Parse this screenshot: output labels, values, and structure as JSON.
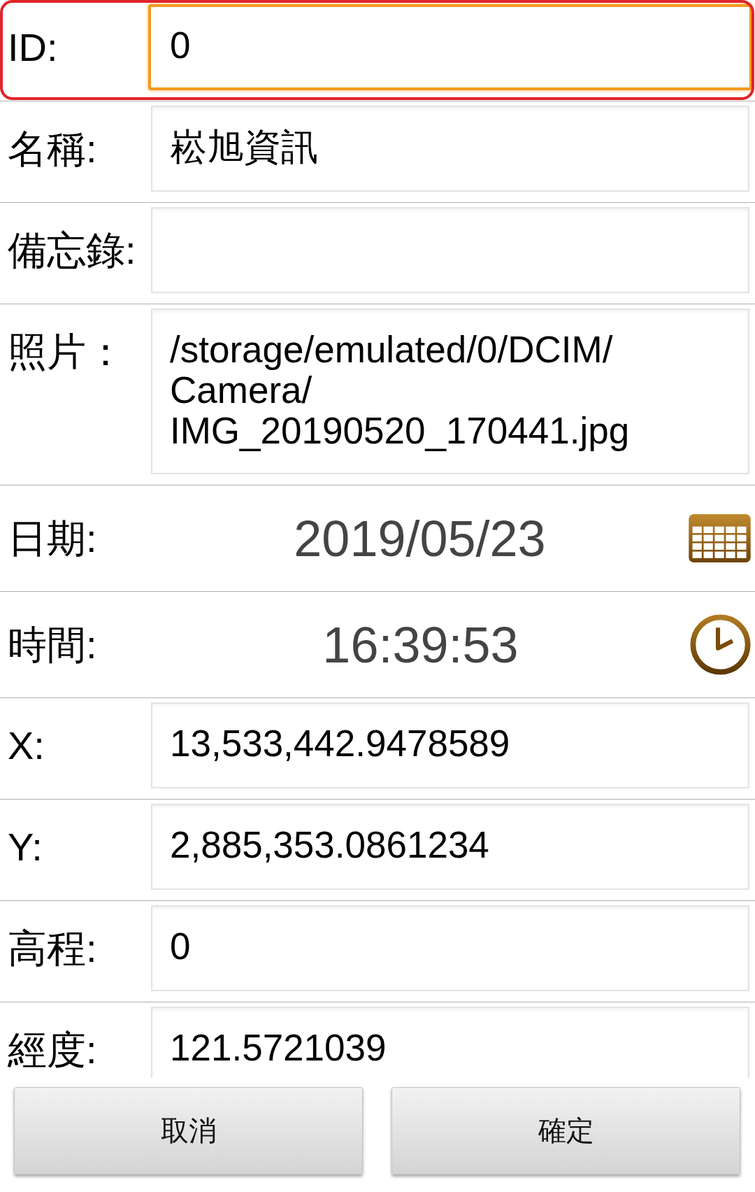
{
  "fields": [
    {
      "kind": "text",
      "label": "ID:",
      "value": "0",
      "focused": true,
      "highlighted": true
    },
    {
      "kind": "text",
      "label": "名稱:",
      "value": "崧旭資訊",
      "focused": false,
      "highlighted": false
    },
    {
      "kind": "text",
      "label": "備忘錄:",
      "focused": false,
      "highlighted": false
    },
    {
      "kind": "text",
      "label": "照片：",
      "value": "/storage/emulated/0/DCIM/Camera/IMG_20190520_170441.jpg",
      "focused": false,
      "highlighted": false
    },
    {
      "kind": "date",
      "label": "日期:",
      "value": "2019/05/23",
      "focused": false,
      "highlighted": false
    },
    {
      "kind": "time",
      "label": "時間:",
      "value": "16:39:53",
      "focused": false,
      "highlighted": false
    },
    {
      "kind": "text",
      "label": "X:",
      "value": "13,533,442.9478589",
      "focused": false,
      "highlighted": false
    },
    {
      "kind": "text",
      "label": "Y:",
      "value": "2,885,353.0861234",
      "focused": false,
      "highlighted": false
    },
    {
      "kind": "text",
      "label": "高程:",
      "value": "0",
      "focused": false,
      "highlighted": false
    },
    {
      "kind": "text",
      "label": "經度:",
      "value": "121.5721039",
      "focused": false,
      "highlighted": false
    }
  ],
  "buttons": [
    {
      "label": "取消"
    },
    {
      "label": "確定"
    }
  ]
}
